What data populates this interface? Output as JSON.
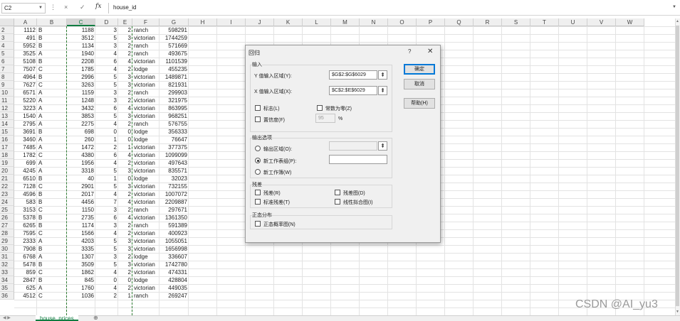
{
  "formula_bar": {
    "name_box": "C2",
    "cancel_icon": "×",
    "enter_icon": "✓",
    "fx": "fx",
    "formula": "house_id"
  },
  "columns": [
    "A",
    "B",
    "C",
    "D",
    "E",
    "F",
    "G",
    "H",
    "I",
    "J",
    "K",
    "L",
    "M",
    "N",
    "O",
    "P",
    "Q",
    "R",
    "S",
    "T",
    "U",
    "V",
    "W"
  ],
  "rows": [
    [
      "2",
      "1112",
      "B",
      "1188",
      "3",
      "2",
      "ranch",
      "598291"
    ],
    [
      "3",
      "491",
      "B",
      "3512",
      "5",
      "3",
      "victorian",
      "1744259"
    ],
    [
      "4",
      "5952",
      "B",
      "1134",
      "3",
      "2",
      "ranch",
      "571669"
    ],
    [
      "5",
      "3525",
      "A",
      "1940",
      "4",
      "2",
      "ranch",
      "493675"
    ],
    [
      "6",
      "5108",
      "B",
      "2208",
      "6",
      "4",
      "victorian",
      "1101539"
    ],
    [
      "7",
      "7507",
      "C",
      "1785",
      "4",
      "2",
      "lodge",
      "455235"
    ],
    [
      "8",
      "4964",
      "B",
      "2996",
      "5",
      "3",
      "victorian",
      "1489871"
    ],
    [
      "9",
      "7627",
      "C",
      "3263",
      "5",
      "3",
      "victorian",
      "821931"
    ],
    [
      "10",
      "6571",
      "A",
      "1159",
      "3",
      "2",
      "ranch",
      "299903"
    ],
    [
      "11",
      "5220",
      "A",
      "1248",
      "3",
      "2",
      "victorian",
      "321975"
    ],
    [
      "12",
      "3223",
      "A",
      "3432",
      "6",
      "4",
      "victorian",
      "863995"
    ],
    [
      "13",
      "1540",
      "A",
      "3853",
      "5",
      "3",
      "victorian",
      "968251"
    ],
    [
      "14",
      "2795",
      "A",
      "2275",
      "4",
      "2",
      "ranch",
      "576755"
    ],
    [
      "15",
      "3691",
      "B",
      "698",
      "0",
      "0",
      "lodge",
      "356333"
    ],
    [
      "16",
      "3460",
      "A",
      "260",
      "1",
      "0",
      "lodge",
      "76647"
    ],
    [
      "17",
      "7485",
      "A",
      "1472",
      "2",
      "1",
      "victorian",
      "377375"
    ],
    [
      "18",
      "1782",
      "C",
      "4380",
      "6",
      "4",
      "victorian",
      "1099099"
    ],
    [
      "19",
      "699",
      "A",
      "1956",
      "4",
      "2",
      "victorian",
      "497643"
    ],
    [
      "20",
      "4245",
      "A",
      "3318",
      "5",
      "3",
      "victorian",
      "835571"
    ],
    [
      "21",
      "6510",
      "B",
      "40",
      "1",
      "0",
      "lodge",
      "32023"
    ],
    [
      "22",
      "7128",
      "C",
      "2901",
      "5",
      "3",
      "victorian",
      "732155"
    ],
    [
      "23",
      "4596",
      "B",
      "2017",
      "4",
      "2",
      "victorian",
      "1007072"
    ],
    [
      "24",
      "583",
      "B",
      "4456",
      "7",
      "4",
      "victorian",
      "2209887"
    ],
    [
      "25",
      "3153",
      "C",
      "1150",
      "3",
      "2",
      "ranch",
      "297671"
    ],
    [
      "26",
      "5378",
      "B",
      "2735",
      "6",
      "4",
      "victorian",
      "1361350"
    ],
    [
      "27",
      "6265",
      "B",
      "1174",
      "3",
      "2",
      "ranch",
      "591389"
    ],
    [
      "28",
      "7595",
      "C",
      "1566",
      "4",
      "2",
      "victorian",
      "400923"
    ],
    [
      "29",
      "2333",
      "A",
      "4203",
      "5",
      "3",
      "victorian",
      "1055051"
    ],
    [
      "30",
      "7908",
      "B",
      "3335",
      "5",
      "3",
      "victorian",
      "1656998"
    ],
    [
      "31",
      "6768",
      "A",
      "1307",
      "3",
      "2",
      "lodge",
      "336607"
    ],
    [
      "32",
      "5478",
      "B",
      "3509",
      "5",
      "3",
      "victorian",
      "1742780"
    ],
    [
      "33",
      "859",
      "C",
      "1862",
      "4",
      "2",
      "victorian",
      "474331"
    ],
    [
      "34",
      "2847",
      "B",
      "845",
      "0",
      "0",
      "lodge",
      "428804"
    ],
    [
      "35",
      "625",
      "A",
      "1760",
      "4",
      "2",
      "victorian",
      "449035"
    ],
    [
      "36",
      "4512",
      "C",
      "1036",
      "2",
      "1",
      "ranch",
      "269247"
    ]
  ],
  "sheet_tab": "house_prices",
  "add_sheet": "⊕",
  "watermark": "CSDN @AI_yu3",
  "dialog": {
    "title": "回归",
    "help_icon": "?",
    "close_icon": "✕",
    "input_group": "输入",
    "y_label": "Y 值输入区域(Y):",
    "y_value": "$G$2:$G$6029",
    "x_label": "X 值输入区域(X):",
    "x_value": "$C$2:$E$6029",
    "collapse_glyph": "⇞",
    "labels_chk": "标志(L)",
    "const_zero_chk": "常数为零(Z)",
    "confidence_chk": "置信度(F)",
    "confidence_value": "95",
    "percent": "%",
    "output_group": "输出选项",
    "out_range": "输出区域(O):",
    "new_sheet": "新工作表组(P):",
    "new_book": "新工作簿(W)",
    "residuals_group": "残差",
    "residuals": "残差(R)",
    "resid_plot": "残差图(D)",
    "std_resid": "标准残差(T)",
    "line_fit": "线性拟合图(I)",
    "normal_group": "正态分布",
    "normal_plot": "正态概率图(N)",
    "ok": "确定",
    "cancel": "取消",
    "help": "帮助(H)"
  }
}
